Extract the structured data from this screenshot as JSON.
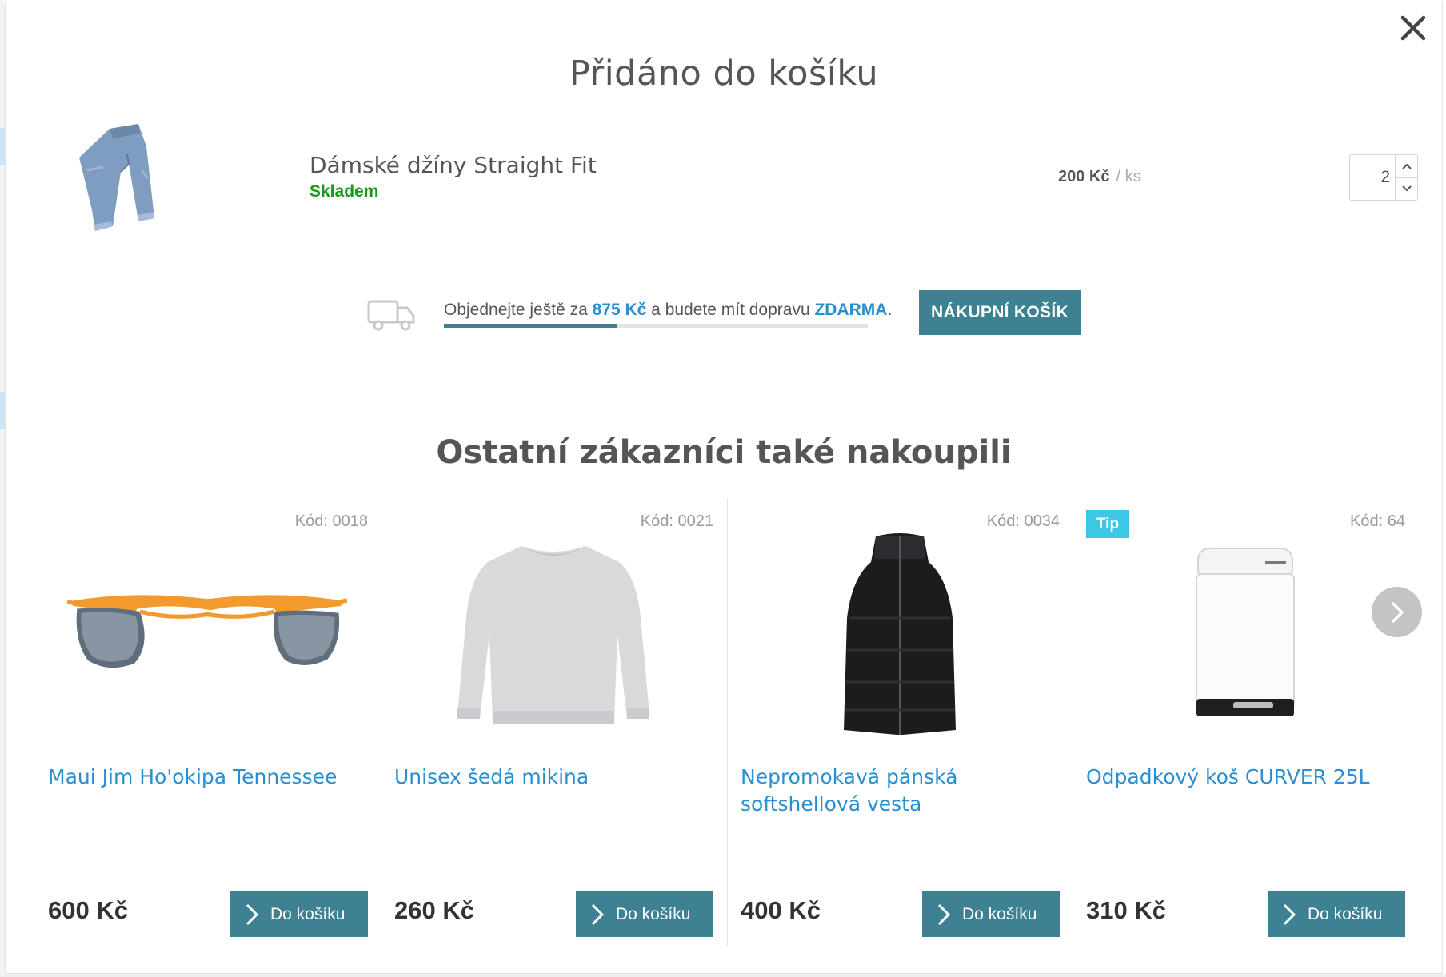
{
  "modal": {
    "title": "Přidáno do košíku",
    "close_icon": "close-icon"
  },
  "added_item": {
    "name": "Dámské džíny Straight Fit",
    "stock": "Skladem",
    "price": "200 Kč",
    "unit": "/ ks",
    "quantity": "2",
    "image_icon": "jeans-image"
  },
  "shipping": {
    "text_before": "Objednejte ještě za ",
    "amount": "875 Kč",
    "text_middle": " a budete mít dopravu ",
    "free_label": "ZDARMA",
    "text_end": ".",
    "progress_fraction": 0.41,
    "icon": "truck-icon"
  },
  "cart_button": "NÁKUPNÍ KOŠÍK",
  "recommendations": {
    "title": "Ostatní zákazníci také nakoupili",
    "products": [
      {
        "code": "Kód: 0018",
        "tip": "",
        "name": "Maui Jim Ho'okipa Tennessee",
        "price": "600 Kč",
        "button": "Do košíku",
        "image": "sunglasses-image"
      },
      {
        "code": "Kód: 0021",
        "tip": "",
        "name": "Unisex šedá mikina",
        "price": "260 Kč",
        "button": "Do košíku",
        "image": "sweatshirt-image"
      },
      {
        "code": "Kód: 0034",
        "tip": "",
        "name": "Nepromokavá pánská softshellová vesta",
        "price": "400 Kč",
        "button": "Do košíku",
        "image": "vest-image"
      },
      {
        "code": "Kód: 64",
        "tip": "Tip",
        "name": "Odpadkový koš CURVER 25L",
        "price": "310 Kč",
        "button": "Do košíku",
        "image": "trash-bin-image"
      }
    ],
    "next_icon": "chevron-right-icon"
  },
  "colors": {
    "accent": "#3d8192",
    "link": "#2a8fd1",
    "stock_green": "#1a9a1a",
    "tip_badge": "#3cc7e6"
  }
}
